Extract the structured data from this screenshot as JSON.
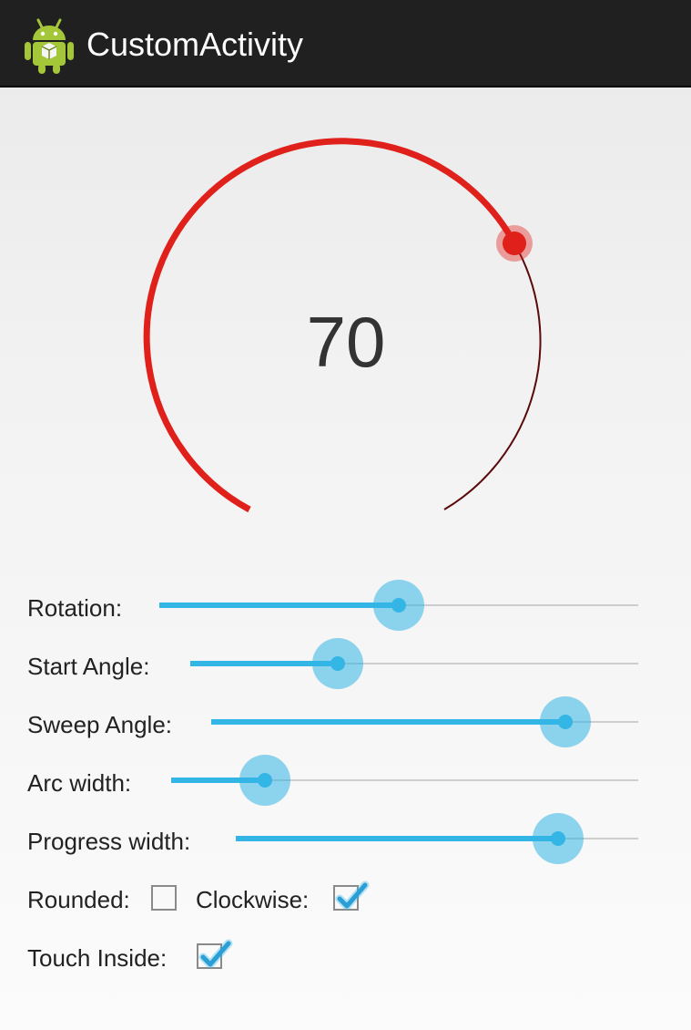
{
  "action_bar": {
    "title": "CustomActivity",
    "icon": "android-robot-icon"
  },
  "arc": {
    "progress_text": "70",
    "progress_color": "#e0201a",
    "track_color": "#5a0a0a",
    "thumb_color": "#e0201a"
  },
  "settings": {
    "rotation": {
      "label": "Rotation:",
      "value_fraction": 0.5
    },
    "start_angle": {
      "label": "Start Angle:",
      "value_fraction": 0.33
    },
    "sweep_angle": {
      "label": "Sweep Angle:",
      "value_fraction": 0.83
    },
    "arc_width": {
      "label": "Arc width:",
      "value_fraction": 0.2
    },
    "progress_width": {
      "label": "Progress width:",
      "value_fraction": 0.8
    },
    "rounded": {
      "label": "Rounded:",
      "checked": false
    },
    "clockwise": {
      "label": "Clockwise:",
      "checked": true
    },
    "touch_inside": {
      "label": "Touch Inside:",
      "checked": true
    }
  },
  "colors": {
    "accent": "#33b5e5",
    "action_bar": "#202020"
  }
}
